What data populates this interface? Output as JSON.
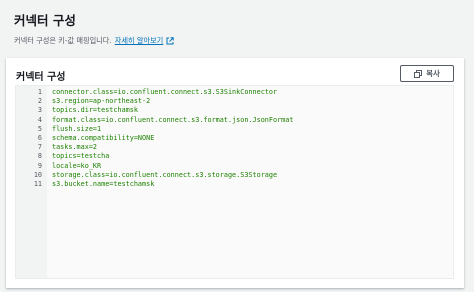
{
  "header": {
    "title": "커넥터 구성",
    "description": "커넥터 구성은 키-값 매핑입니다.",
    "learn_more": "자세히 알아보기",
    "external_icon": "external-link-icon"
  },
  "panel": {
    "title": "커넥터 구성",
    "copy_label": "복사",
    "copy_icon": "copy-icon"
  },
  "code_lines": [
    {
      "n": "1",
      "text": "connector.class=io.confluent.connect.s3.S3SinkConnector"
    },
    {
      "n": "2",
      "text": "s3.region=ap-northeast-2"
    },
    {
      "n": "3",
      "text": "topics.dir=testchamsk"
    },
    {
      "n": "4",
      "text": "format.class=io.confluent.connect.s3.format.json.JsonFormat"
    },
    {
      "n": "5",
      "text": "flush.size=1"
    },
    {
      "n": "6",
      "text": "schema.compatibility=NONE"
    },
    {
      "n": "7",
      "text": "tasks.max=2"
    },
    {
      "n": "8",
      "text": "topics=testcha"
    },
    {
      "n": "9",
      "text": "locale=ko_KR"
    },
    {
      "n": "10",
      "text": "storage.class=io.confluent.connect.s3.storage.S3Storage"
    },
    {
      "n": "11",
      "text": "s3.bucket.name=testchamsk"
    }
  ],
  "colors": {
    "link": "#0073bb",
    "code_text": "#1d8102",
    "line_number": "#545b64"
  }
}
